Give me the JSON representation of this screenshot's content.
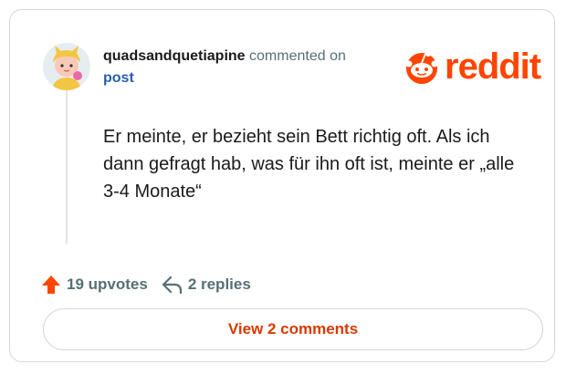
{
  "comment": {
    "username": "quadsandquetiapine",
    "action_text": " commented on",
    "target_link": "post",
    "body": "Er meinte, er bezieht sein Bett richtig oft. Als ich dann gefragt hab, was für ihn oft ist, meinte er „alle 3-4 Monate“"
  },
  "brand": {
    "wordmark": "reddit",
    "color": "#ff4500",
    "icon": "reddit-snoo-icon"
  },
  "stats": {
    "upvotes_label": "19 upvotes",
    "upvote_icon": "upvote-arrow-icon",
    "upvote_color": "#ff4500",
    "replies_label": "2 replies",
    "reply_icon": "reply-arrow-icon"
  },
  "actions": {
    "view_comments_label": "View 2 comments",
    "accent_color": "#d93a00"
  },
  "avatar": {
    "icon": "avatar-icon"
  }
}
